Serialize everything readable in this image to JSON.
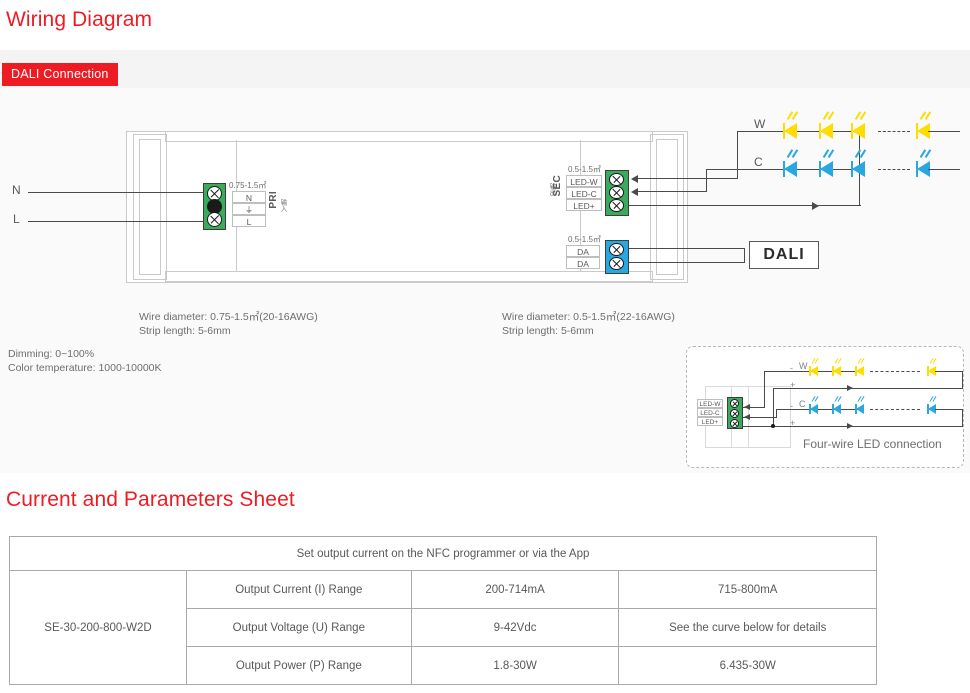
{
  "sections": {
    "wiring_title": "Wiring Diagram",
    "params_title": "Current and Parameters Sheet"
  },
  "badge": {
    "label": "DALI Connection",
    "color": "#ed1c24"
  },
  "diagram": {
    "input_labels": {
      "neutral": "N",
      "live": "L"
    },
    "primary_terminal": {
      "gauge": "0.75-1.5㎡",
      "side_label": "PRI",
      "side_sub": "输入",
      "rows": [
        "N",
        "⏚",
        "L"
      ]
    },
    "secondary_terminal": {
      "gauge": "0.5-1.5㎡",
      "side_label": "SEC",
      "side_sub": "输出",
      "rows": [
        "LED-W",
        "LED-C",
        "LED+"
      ]
    },
    "dali_terminal": {
      "gauge": "0.5-1.5㎡",
      "rows": [
        "DA",
        "DA"
      ]
    },
    "dali_box_label": "DALI",
    "led_strings": [
      {
        "name": "W",
        "label": "W",
        "color": "#ffdd00"
      },
      {
        "name": "C",
        "label": "C",
        "color": "#29a7e1"
      }
    ],
    "captions": {
      "primary_line1": "Wire diameter: 0.75-1.5㎡(20-16AWG)",
      "primary_line2": "Strip length: 5-6mm",
      "secondary_line1": "Wire diameter: 0.5-1.5㎡(22-16AWG)",
      "secondary_line2": "Strip length: 5-6mm"
    },
    "specs": {
      "dimming": "Dimming: 0~100%",
      "cct": "Color temperature: 1000-10000K"
    },
    "inset": {
      "title": "Four-wire LED connection",
      "terminal_rows": [
        "LED-W",
        "LED-C",
        "LED+"
      ],
      "string_labels": [
        "W",
        "C"
      ],
      "polarity_minus": "-",
      "polarity_plus": "+"
    }
  },
  "table": {
    "header": "Set output current on the NFC programmer or via the App",
    "model": "SE-30-200-800-W2D",
    "rows": [
      {
        "param": "Output Current (I) Range",
        "value1": "200-714mA",
        "value2": "715-800mA"
      },
      {
        "param": "Output Voltage (U) Range",
        "value1": "9-42Vdc",
        "value2": "See the curve below for details"
      },
      {
        "param": "Output Power (P) Range",
        "value1": "1.8-30W",
        "value2": "6.435-30W"
      }
    ]
  }
}
